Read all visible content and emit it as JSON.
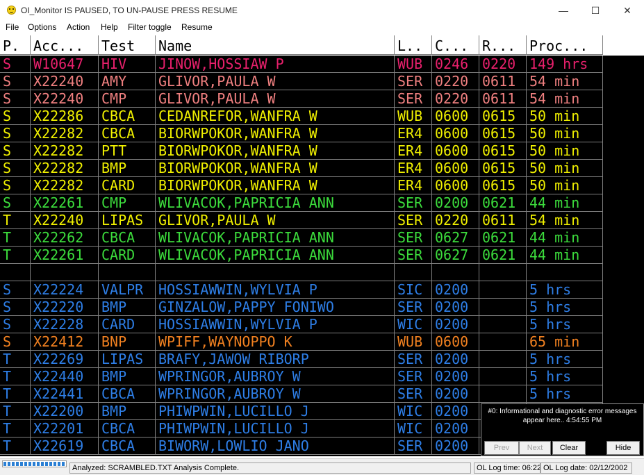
{
  "window": {
    "title": "OI_Monitor IS PAUSED, TO UN-PAUSE PRESS RESUME",
    "minimize": "—",
    "maximize": "☐",
    "close": "✕"
  },
  "menu": [
    "File",
    "Options",
    "Action",
    "Help",
    "Filter toggle",
    "Resume"
  ],
  "table": {
    "headers": [
      "P.",
      "Acc...",
      "Test",
      "Name",
      "L..",
      "C...",
      "R...",
      "Proc..."
    ],
    "rows": [
      {
        "p": "S",
        "acc": "W10647",
        "test": "HIV",
        "name": "JINOW,HOSSIAW P",
        "loc": "WUB",
        "c": "0246",
        "r": "0220",
        "proc": "149 hrs",
        "color": "#e8206c"
      },
      {
        "p": "S",
        "acc": "X22240",
        "test": "AMY",
        "name": "GLIVOR,PAULA W",
        "loc": "SER",
        "c": "0220",
        "r": "0611",
        "proc": "54 min",
        "color": "#f08080"
      },
      {
        "p": "S",
        "acc": "X22240",
        "test": "CMP",
        "name": "GLIVOR,PAULA W",
        "loc": "SER",
        "c": "0220",
        "r": "0611",
        "proc": "54 min",
        "color": "#f08080"
      },
      {
        "p": "S",
        "acc": "X22286",
        "test": "CBCA",
        "name": "CEDANREFOR,WANFRA W",
        "loc": "WUB",
        "c": "0600",
        "r": "0615",
        "proc": "50 min",
        "color": "#f0f000"
      },
      {
        "p": "S",
        "acc": "X22282",
        "test": "CBCA",
        "name": "BIORWPOKOR,WANFRA W",
        "loc": "ER4",
        "c": "0600",
        "r": "0615",
        "proc": "50 min",
        "color": "#f0f000"
      },
      {
        "p": "S",
        "acc": "X22282",
        "test": "PTT",
        "name": "BIORWPOKOR,WANFRA W",
        "loc": "ER4",
        "c": "0600",
        "r": "0615",
        "proc": "50 min",
        "color": "#f0f000"
      },
      {
        "p": "S",
        "acc": "X22282",
        "test": "BMP",
        "name": "BIORWPOKOR,WANFRA W",
        "loc": "ER4",
        "c": "0600",
        "r": "0615",
        "proc": "50 min",
        "color": "#f0f000"
      },
      {
        "p": "S",
        "acc": "X22282",
        "test": "CARD",
        "name": "BIORWPOKOR,WANFRA W",
        "loc": "ER4",
        "c": "0600",
        "r": "0615",
        "proc": "50 min",
        "color": "#f0f000"
      },
      {
        "p": "S",
        "acc": "X22261",
        "test": "CMP",
        "name": "WLIVACOK,PAPRICIA ANN",
        "loc": "SER",
        "c": "0200",
        "r": "0621",
        "proc": "44 min",
        "color": "#3cdc3c"
      },
      {
        "p": "T",
        "acc": "X22240",
        "test": "LIPAS",
        "name": "GLIVOR,PAULA W",
        "loc": "SER",
        "c": "0220",
        "r": "0611",
        "proc": "54 min",
        "color": "#f0f000"
      },
      {
        "p": "T",
        "acc": "X22262",
        "test": "CBCA",
        "name": "WLIVACOK,PAPRICIA ANN",
        "loc": "SER",
        "c": "0627",
        "r": "0621",
        "proc": "44 min",
        "color": "#3cdc3c"
      },
      {
        "p": "T",
        "acc": "X22261",
        "test": "CARD",
        "name": "WLIVACOK,PAPRICIA ANN",
        "loc": "SER",
        "c": "0627",
        "r": "0621",
        "proc": "44 min",
        "color": "#3cdc3c"
      },
      {
        "p": "",
        "acc": "",
        "test": "",
        "name": "",
        "loc": "",
        "c": "",
        "r": "",
        "proc": "",
        "color": "#ffffff"
      },
      {
        "p": "S",
        "acc": "X22224",
        "test": "VALPR",
        "name": "HOSSIAWWIN,WYLVIA P",
        "loc": "SIC",
        "c": "0200",
        "r": "",
        "proc": "5 hrs",
        "color": "#2e7ee6"
      },
      {
        "p": "S",
        "acc": "X22220",
        "test": "BMP",
        "name": "GINZALOW,PAPPY FONIWO",
        "loc": "SER",
        "c": "0200",
        "r": "",
        "proc": "5 hrs",
        "color": "#2e7ee6"
      },
      {
        "p": "S",
        "acc": "X22228",
        "test": "CARD",
        "name": "HOSSIAWWIN,WYLVIA P",
        "loc": "WIC",
        "c": "0200",
        "r": "",
        "proc": "5 hrs",
        "color": "#2e7ee6"
      },
      {
        "p": "S",
        "acc": "X22412",
        "test": "BNP",
        "name": "WPIFF,WAYNOPPO K",
        "loc": "WUB",
        "c": "0600",
        "r": "",
        "proc": "65 min",
        "color": "#f08020"
      },
      {
        "p": "T",
        "acc": "X22269",
        "test": "LIPAS",
        "name": "BRAFY,JAWOW RIBORP",
        "loc": "SER",
        "c": "0200",
        "r": "",
        "proc": "5 hrs",
        "color": "#2e7ee6"
      },
      {
        "p": "T",
        "acc": "X22440",
        "test": "BMP",
        "name": "WPRINGOR,AUBROY W",
        "loc": "SER",
        "c": "0200",
        "r": "",
        "proc": "5 hrs",
        "color": "#2e7ee6"
      },
      {
        "p": "T",
        "acc": "X22441",
        "test": "CBCA",
        "name": "WPRINGOR,AUBROY W",
        "loc": "SER",
        "c": "0200",
        "r": "",
        "proc": "5 hrs",
        "color": "#2e7ee6"
      },
      {
        "p": "T",
        "acc": "X22200",
        "test": "BMP",
        "name": "PHIWPWIN,LUCILLO J",
        "loc": "WIC",
        "c": "0200",
        "r": "",
        "proc": "",
        "color": "#2e7ee6"
      },
      {
        "p": "T",
        "acc": "X22201",
        "test": "CBCA",
        "name": "PHIWPWIN,LUCILLO J",
        "loc": "WIC",
        "c": "0200",
        "r": "",
        "proc": "",
        "color": "#2e7ee6"
      },
      {
        "p": "T",
        "acc": "X22619",
        "test": "CBCA",
        "name": "BIWORW,LOWLIO JANO",
        "loc": "SER",
        "c": "0200",
        "r": "",
        "proc": "",
        "color": "#2e7ee6"
      }
    ]
  },
  "messages": {
    "text": "#0: Informational and diagnostic error messages appear here..   4:54:55 PM",
    "prev": "Prev",
    "next": "Next",
    "clear": "Clear",
    "hide": "Hide"
  },
  "status": {
    "progress": 1.0,
    "analyzed": "Analyzed: SCRAMBLED.TXT Analysis Complete.",
    "log_time": "OL Log time: 06:22",
    "log_date": "OL Log date: 02/12/2002"
  }
}
